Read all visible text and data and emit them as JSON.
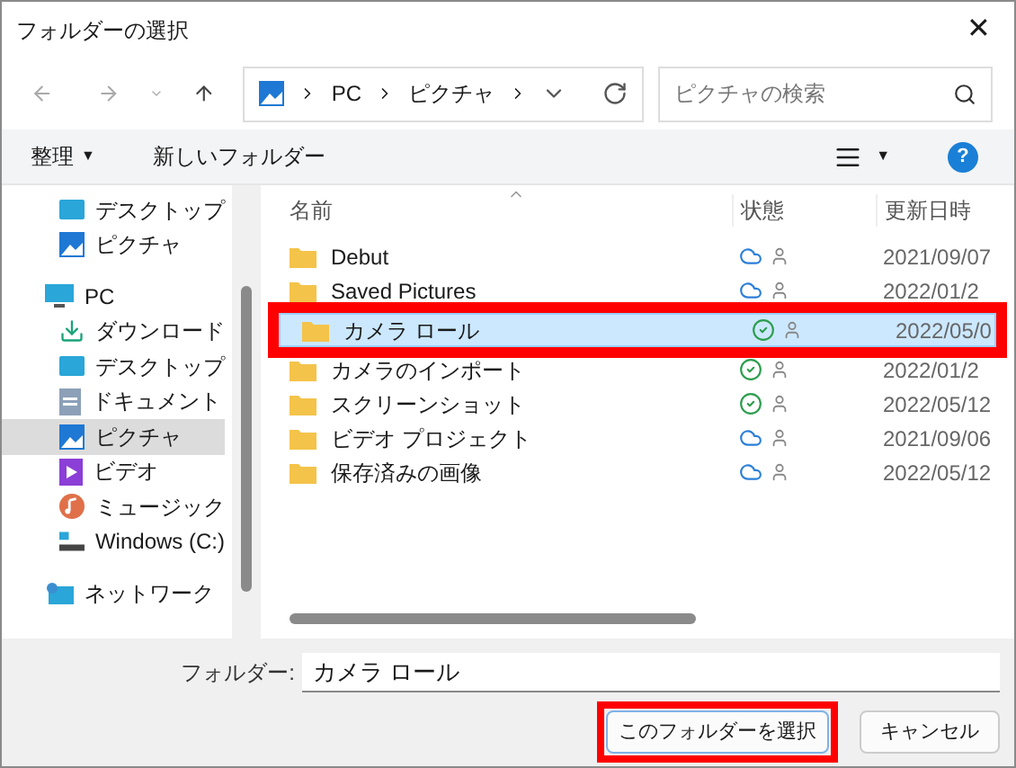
{
  "window": {
    "title": "フォルダーの選択",
    "close": "✕"
  },
  "address": {
    "segments": [
      "PC",
      "ピクチャ"
    ],
    "search_placeholder": "ピクチャの検索"
  },
  "toolbar": {
    "organize": "整理",
    "organize_caret": "▼",
    "new_folder": "新しいフォルダー",
    "view_caret": "▼",
    "help": "?"
  },
  "sidebar": {
    "partial_group": [
      {
        "label": "デスクトップ",
        "selected": false
      },
      {
        "label": "ピクチャ",
        "selected": false
      }
    ],
    "items": [
      {
        "label": "PC",
        "selected": false,
        "children": [
          {
            "label": "ダウンロード",
            "selected": false
          },
          {
            "label": "デスクトップ",
            "selected": false
          },
          {
            "label": "ドキュメント",
            "selected": false
          },
          {
            "label": "ピクチャ",
            "selected": true
          },
          {
            "label": "ビデオ",
            "selected": false
          },
          {
            "label": "ミュージック",
            "selected": false
          },
          {
            "label": "Windows (C:)",
            "selected": false
          }
        ]
      },
      {
        "label": "ネットワーク",
        "selected": false
      }
    ]
  },
  "table": {
    "columns": [
      "名前",
      "状態",
      "更新日時"
    ],
    "rows": [
      {
        "name": "Debut",
        "kind": "cloud",
        "date": "2021/09/07",
        "selected": false,
        "highlighted": false
      },
      {
        "name": "Saved Pictures",
        "kind": "cloud",
        "date": "2022/01/2",
        "selected": false,
        "highlighted": false
      },
      {
        "name": "カメラ ロール",
        "kind": "synced",
        "date": "2022/05/0",
        "selected": true,
        "highlighted": true
      },
      {
        "name": "カメラのインポート",
        "kind": "synced",
        "date": "2022/01/2",
        "selected": false,
        "highlighted": false
      },
      {
        "name": "スクリーンショット",
        "kind": "synced",
        "date": "2022/05/12",
        "selected": false,
        "highlighted": false
      },
      {
        "name": "ビデオ プロジェクト",
        "kind": "cloud",
        "date": "2021/09/06",
        "selected": false,
        "highlighted": false
      },
      {
        "name": "保存済みの画像",
        "kind": "cloud",
        "date": "2022/05/12",
        "selected": false,
        "highlighted": false
      }
    ]
  },
  "footer": {
    "folder_label": "フォルダー:",
    "folder_value": "カメラ ロール",
    "buttons": [
      {
        "label": "このフォルダーを選択",
        "highlighted": true
      },
      {
        "label": "キャンセル",
        "highlighted": false
      }
    ]
  }
}
